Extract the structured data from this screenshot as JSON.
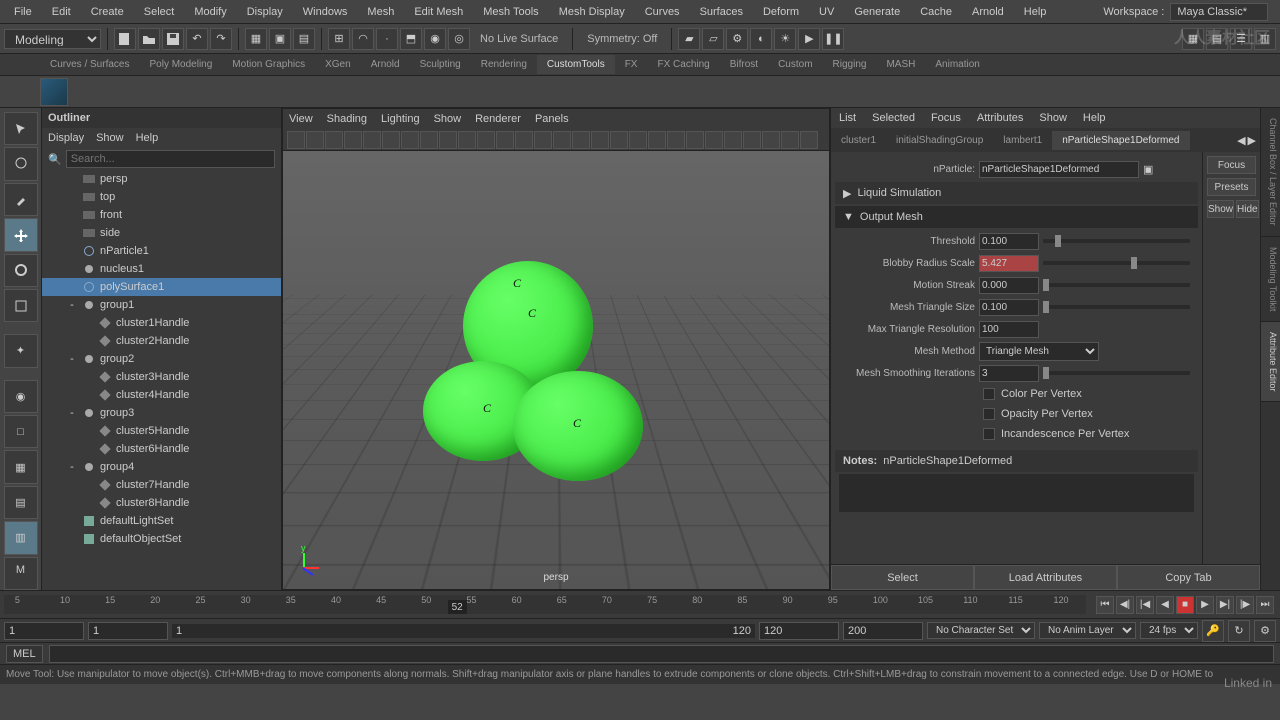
{
  "menubar": [
    "File",
    "Edit",
    "Create",
    "Select",
    "Modify",
    "Display",
    "Windows",
    "Mesh",
    "Edit Mesh",
    "Mesh Tools",
    "Mesh Display",
    "Curves",
    "Surfaces",
    "Deform",
    "UV",
    "Generate",
    "Cache",
    "Arnold",
    "Help"
  ],
  "workspace": {
    "label": "Workspace :",
    "value": "Maya Classic*"
  },
  "mode": "Modeling",
  "live_surface": "No Live Surface",
  "symmetry": "Symmetry: Off",
  "shelf_tabs": [
    "Curves / Surfaces",
    "Poly Modeling",
    "Motion Graphics",
    "XGen",
    "Arnold",
    "Sculpting",
    "Rendering",
    "CustomTools",
    "FX",
    "FX Caching",
    "Bifrost",
    "Custom",
    "Rigging",
    "MASH",
    "Animation"
  ],
  "shelf_active": "CustomTools",
  "outliner": {
    "title": "Outliner",
    "menu": [
      "Display",
      "Show",
      "Help"
    ],
    "search_placeholder": "Search...",
    "items": [
      {
        "label": "persp",
        "type": "cam",
        "dim": true,
        "indent": 1
      },
      {
        "label": "top",
        "type": "cam",
        "dim": true,
        "indent": 1
      },
      {
        "label": "front",
        "type": "cam",
        "dim": true,
        "indent": 1
      },
      {
        "label": "side",
        "type": "cam",
        "dim": true,
        "indent": 1
      },
      {
        "label": "nParticle1",
        "type": "mesh",
        "indent": 1
      },
      {
        "label": "nucleus1",
        "type": "node",
        "indent": 1
      },
      {
        "label": "polySurface1",
        "type": "mesh",
        "indent": 1,
        "selected": true
      },
      {
        "label": "group1",
        "type": "node",
        "indent": 1,
        "toggle": "-"
      },
      {
        "label": "cluster1Handle",
        "type": "handle",
        "indent": 2
      },
      {
        "label": "cluster2Handle",
        "type": "handle",
        "indent": 2
      },
      {
        "label": "group2",
        "type": "node",
        "indent": 1,
        "toggle": "-"
      },
      {
        "label": "cluster3Handle",
        "type": "handle",
        "indent": 2
      },
      {
        "label": "cluster4Handle",
        "type": "handle",
        "indent": 2
      },
      {
        "label": "group3",
        "type": "node",
        "indent": 1,
        "toggle": "-"
      },
      {
        "label": "cluster5Handle",
        "type": "handle",
        "indent": 2
      },
      {
        "label": "cluster6Handle",
        "type": "handle",
        "indent": 2
      },
      {
        "label": "group4",
        "type": "node",
        "indent": 1,
        "toggle": "-"
      },
      {
        "label": "cluster7Handle",
        "type": "handle",
        "indent": 2
      },
      {
        "label": "cluster8Handle",
        "type": "handle",
        "indent": 2
      },
      {
        "label": "defaultLightSet",
        "type": "set",
        "indent": 1
      },
      {
        "label": "defaultObjectSet",
        "type": "set",
        "indent": 1
      }
    ]
  },
  "viewport": {
    "menu": [
      "View",
      "Shading",
      "Lighting",
      "Show",
      "Renderer",
      "Panels"
    ],
    "camera": "persp",
    "axis_y": "y"
  },
  "attr": {
    "menu": [
      "List",
      "Selected",
      "Focus",
      "Attributes",
      "Show",
      "Help"
    ],
    "tabs": [
      "cluster1",
      "initialShadingGroup",
      "lambert1",
      "nParticleShape1Deformed"
    ],
    "active_tab": "nParticleShape1Deformed",
    "side": [
      "Focus",
      "Presets",
      "Show",
      "Hide"
    ],
    "node_type": "nParticle:",
    "node_name": "nParticleShape1Deformed",
    "sections": {
      "liquid": "Liquid Simulation",
      "output": "Output Mesh"
    },
    "rows": [
      {
        "label": "Threshold",
        "value": "0.100",
        "slider": 8
      },
      {
        "label": "Blobby Radius Scale",
        "value": "5.427",
        "slider": 60,
        "hl": true
      },
      {
        "label": "Motion Streak",
        "value": "0.000",
        "slider": 0
      },
      {
        "label": "Mesh Triangle Size",
        "value": "0.100",
        "slider": 0
      },
      {
        "label": "Max Triangle Resolution",
        "value": "100"
      },
      {
        "label": "Mesh Method",
        "value": "Triangle Mesh",
        "dropdown": true
      },
      {
        "label": "Mesh Smoothing Iterations",
        "value": "3",
        "slider": 0
      }
    ],
    "checks": [
      "Color Per Vertex",
      "Opacity Per Vertex",
      "Incandescence Per Vertex"
    ],
    "notes_label": "Notes:",
    "notes_value": "nParticleShape1Deformed",
    "bottom": [
      "Select",
      "Load Attributes",
      "Copy Tab"
    ]
  },
  "right_tabs": [
    "Channel Box / Layer Editor",
    "Modeling Toolkit",
    "Attribute Editor"
  ],
  "timeline": {
    "ticks": [
      5,
      10,
      15,
      20,
      25,
      30,
      35,
      40,
      45,
      50,
      55,
      60,
      65,
      70,
      75,
      80,
      85,
      90,
      95,
      100,
      105,
      110,
      115,
      120
    ],
    "current": 52
  },
  "range": {
    "start": "1",
    "end": "120",
    "min": "1",
    "max": "120",
    "total_end": "200",
    "char_set": "No Character Set",
    "anim_layer": "No Anim Layer",
    "fps": "24 fps"
  },
  "cmd": "MEL",
  "help": "Move Tool: Use manipulator to move object(s). Ctrl+MMB+drag to move components along normals. Shift+drag manipulator axis or plane handles to extrude components or clone objects. Ctrl+Shift+LMB+drag to constrain movement to a connected edge. Use D or HOME to",
  "watermark": "人人素材社区",
  "linkedin": "Linked in"
}
